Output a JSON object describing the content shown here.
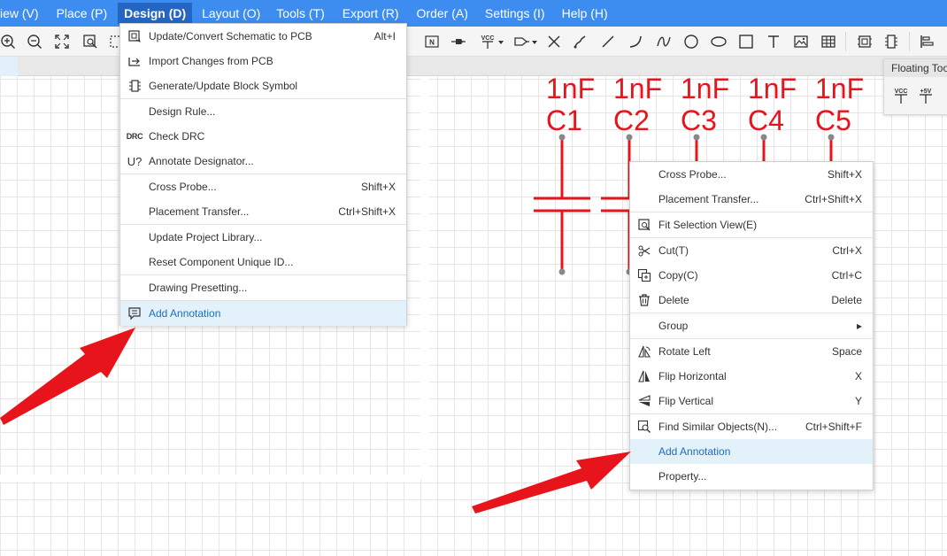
{
  "menubar": {
    "items": [
      "iew (V)",
      "Place (P)",
      "Design (D)",
      "Layout (O)",
      "Tools (T)",
      "Export (R)",
      "Order (A)",
      "Settings (I)",
      "Help (H)"
    ],
    "active": "Design (D)"
  },
  "toolbar": {
    "icons": [
      "zoom-in-icon",
      "zoom-out-icon",
      "fit-all-icon",
      "zoom-area-icon",
      "net-label-icon",
      "net-port-icon",
      "vcc-icon",
      "bus-entry-icon",
      "no-connect-icon",
      "wire-icon",
      "line-icon",
      "arc-icon",
      "bezier-icon",
      "circle-icon",
      "ellipse-icon",
      "rectangle-icon",
      "text-icon",
      "image-icon",
      "table-icon",
      "footprint-icon",
      "symbol-icon",
      "align-icon"
    ],
    "vcc_label": "VCC"
  },
  "floating_toolbar": {
    "title": "Floating Toolbar",
    "vcc_label": "VCC",
    "plus5v_label": "+5V"
  },
  "components": [
    {
      "value": "1nF",
      "designator": "C1"
    },
    {
      "value": "1nF",
      "designator": "C2"
    },
    {
      "value": "1nF",
      "designator": "C3"
    },
    {
      "value": "1nF",
      "designator": "C4"
    },
    {
      "value": "1nF",
      "designator": "C5"
    }
  ],
  "design_menu": {
    "items": [
      {
        "label": "Update/Convert Schematic to PCB",
        "shortcut": "Alt+I",
        "icon": "convert-pcb-icon"
      },
      {
        "label": "Import Changes from PCB",
        "shortcut": "",
        "icon": "import-icon"
      },
      {
        "label": "Generate/Update Block Symbol",
        "shortcut": "",
        "icon": "block-symbol-icon"
      },
      {
        "label": "Design Rule...",
        "shortcut": "",
        "icon": ""
      },
      {
        "label": "Check DRC",
        "shortcut": "",
        "icon": "drc-icon",
        "icon_text": "DRC"
      },
      {
        "label": "Annotate Designator...",
        "shortcut": "",
        "icon": "annotate-designator-icon",
        "icon_text": "U?"
      },
      {
        "label": "Cross Probe...",
        "shortcut": "Shift+X",
        "icon": ""
      },
      {
        "label": "Placement Transfer...",
        "shortcut": "Ctrl+Shift+X",
        "icon": ""
      },
      {
        "label": "Update Project Library...",
        "shortcut": "",
        "icon": ""
      },
      {
        "label": "Reset Component Unique ID...",
        "shortcut": "",
        "icon": ""
      },
      {
        "label": "Drawing Presetting...",
        "shortcut": "",
        "icon": ""
      },
      {
        "label": "Add Annotation",
        "shortcut": "",
        "icon": "annotation-icon"
      }
    ]
  },
  "context_menu": {
    "items": [
      {
        "label": "Cross Probe...",
        "shortcut": "Shift+X",
        "icon": ""
      },
      {
        "label": "Placement Transfer...",
        "shortcut": "Ctrl+Shift+X",
        "icon": ""
      },
      {
        "label": "Fit Selection View(E)",
        "shortcut": "",
        "icon": "fit-selection-icon"
      },
      {
        "label": "Cut(T)",
        "shortcut": "Ctrl+X",
        "icon": "scissors-icon"
      },
      {
        "label": "Copy(C)",
        "shortcut": "Ctrl+C",
        "icon": "copy-icon"
      },
      {
        "label": "Delete",
        "shortcut": "Delete",
        "icon": "trash-icon"
      },
      {
        "label": "Group",
        "shortcut": "",
        "icon": "",
        "submenu": "▸"
      },
      {
        "label": "Rotate Left",
        "shortcut": "Space",
        "icon": "rotate-left-icon"
      },
      {
        "label": "Flip Horizontal",
        "shortcut": "X",
        "icon": "flip-horizontal-icon"
      },
      {
        "label": "Flip Vertical",
        "shortcut": "Y",
        "icon": "flip-vertical-icon"
      },
      {
        "label": "Find Similar Objects(N)...",
        "shortcut": "Ctrl+Shift+F",
        "icon": "find-similar-icon"
      },
      {
        "label": "Add Annotation",
        "shortcut": "",
        "icon": ""
      },
      {
        "label": "Property...",
        "shortcut": "",
        "icon": ""
      }
    ]
  },
  "colors": {
    "menubar": "#3d8cf0",
    "menu_active": "#2566c4",
    "highlight": "#e3f1fb",
    "highlight_text": "#1b6ec2",
    "schematic_red": "#e8141b",
    "arrow_red": "#e8141b"
  }
}
